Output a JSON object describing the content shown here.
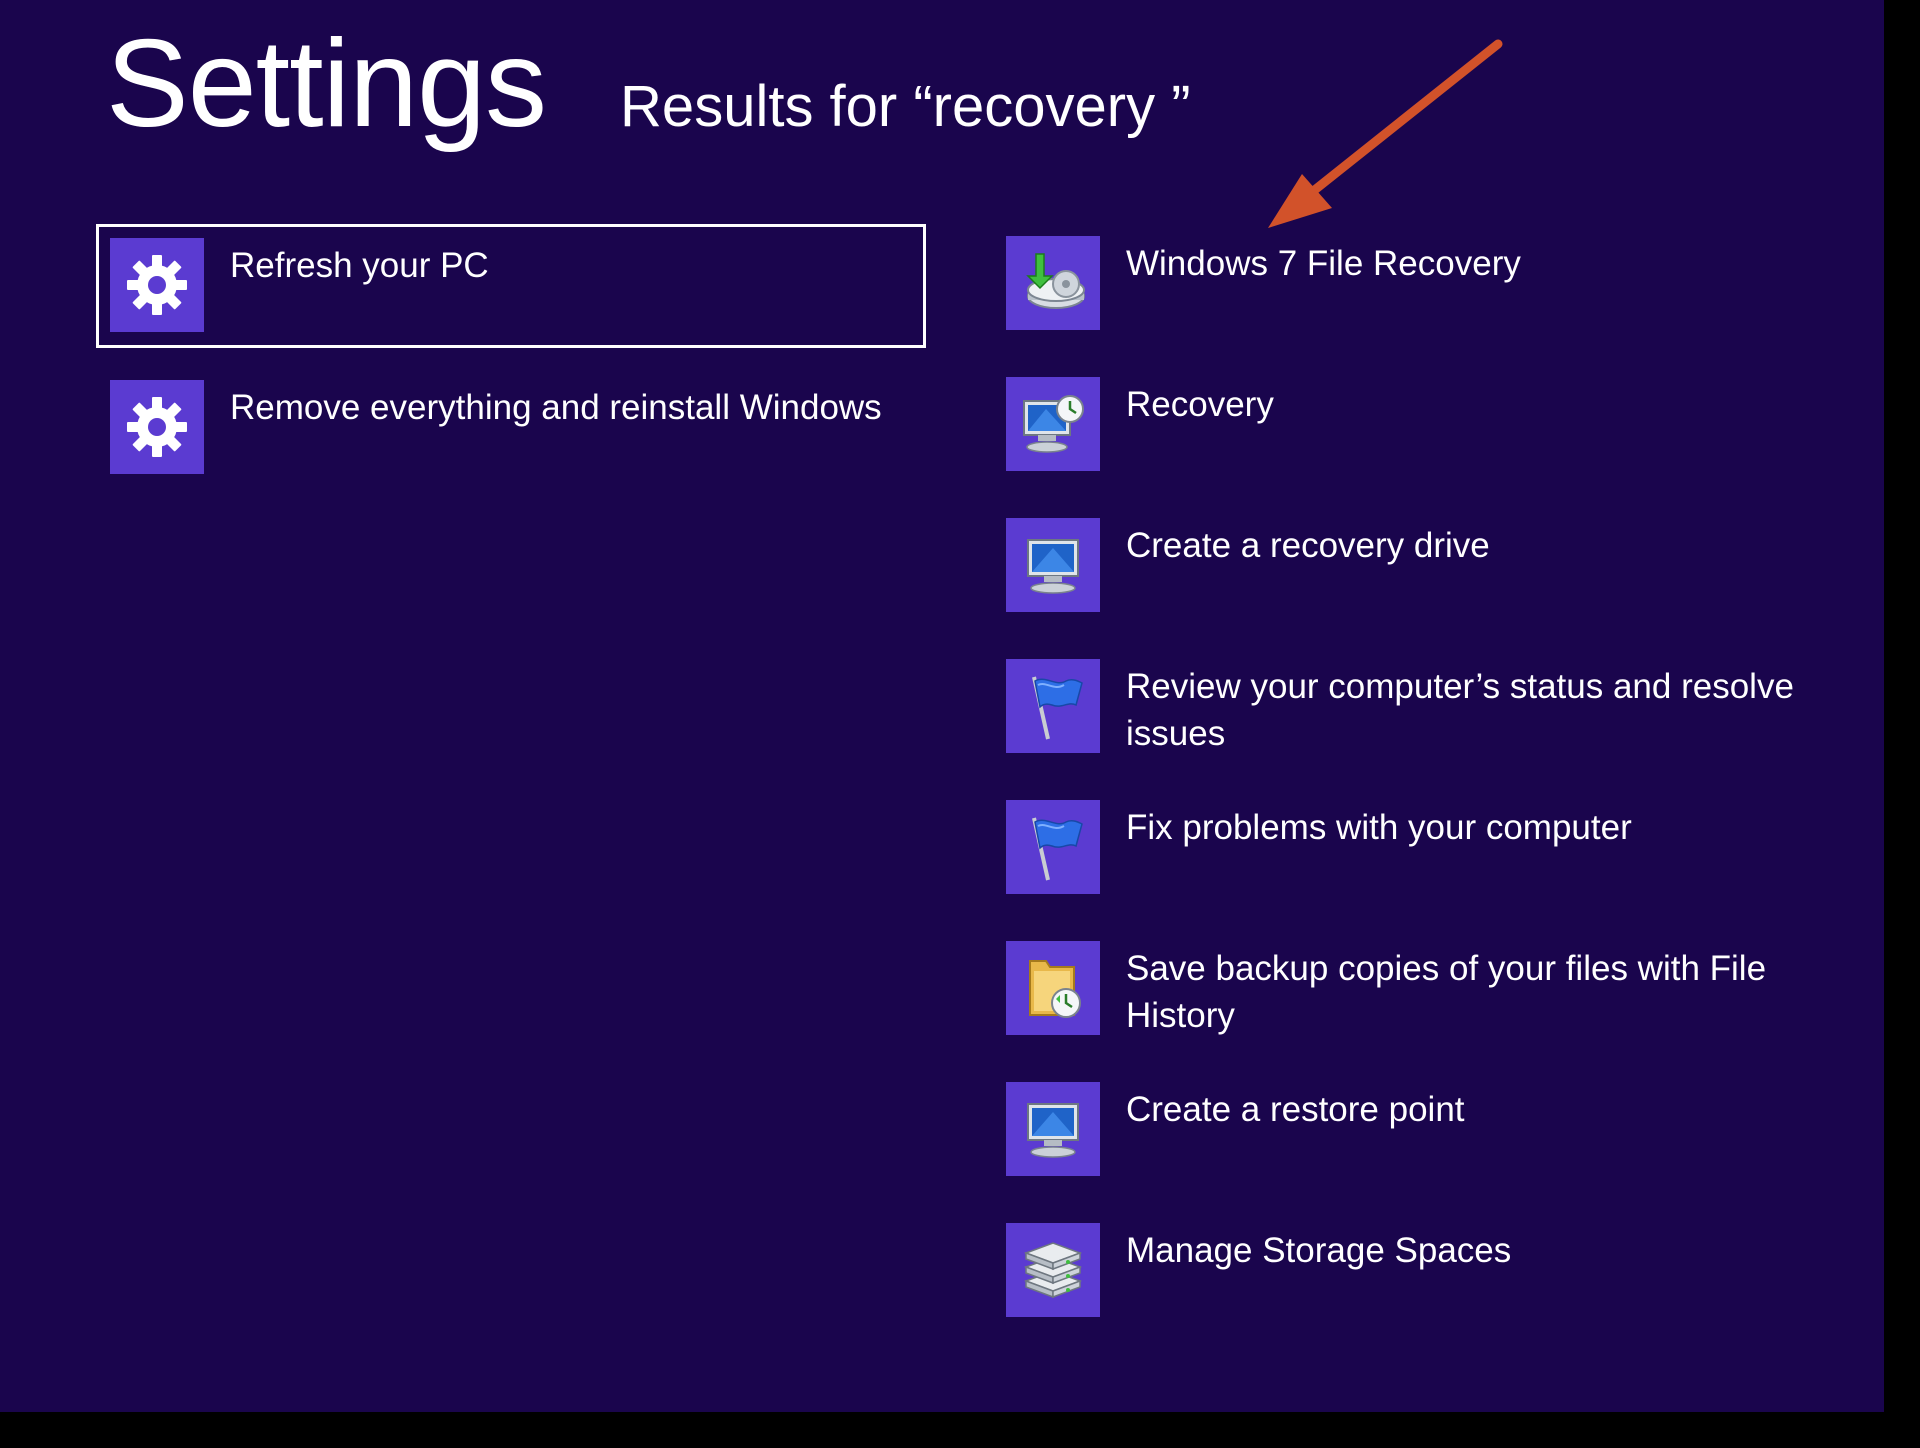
{
  "header": {
    "title": "Settings",
    "subtitle": "Results for “recovery ”"
  },
  "results_left": [
    {
      "label": "Refresh your PC",
      "icon": "gear-icon",
      "selected": true
    },
    {
      "label": "Remove everything and reinstall Windows",
      "icon": "gear-icon",
      "selected": false
    }
  ],
  "results_right": [
    {
      "label": "Windows 7 File Recovery",
      "icon": "backup-disk-icon"
    },
    {
      "label": "Recovery",
      "icon": "monitor-clock-icon"
    },
    {
      "label": "Create a recovery drive",
      "icon": "computer-icon"
    },
    {
      "label": "Review your computer’s status and resolve issues",
      "icon": "flag-icon"
    },
    {
      "label": "Fix problems with your computer",
      "icon": "flag-icon"
    },
    {
      "label": "Save backup copies of your files with File History",
      "icon": "folder-history-icon"
    },
    {
      "label": "Create a restore point",
      "icon": "computer-icon"
    },
    {
      "label": "Manage Storage Spaces",
      "icon": "storage-stack-icon"
    }
  ],
  "colors": {
    "background": "#1a054d",
    "tile": "#5b3bd1",
    "annotation_arrow": "#d2522a"
  }
}
